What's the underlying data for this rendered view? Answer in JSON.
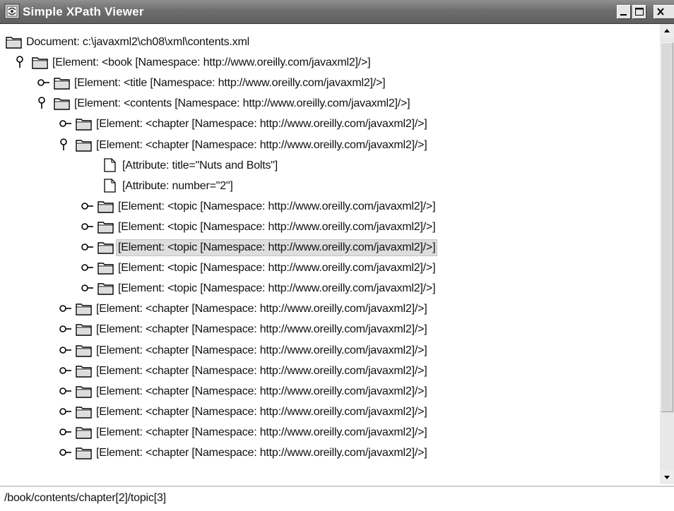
{
  "window": {
    "title": "Simple XPath Viewer",
    "buttons": [
      "minimize",
      "maximize",
      "close"
    ]
  },
  "tree": {
    "rows": [
      {
        "depth": 0,
        "type": "folder",
        "expanded": null,
        "selected": false,
        "label": "Document: c:\\javaxml2\\ch08\\xml\\contents.xml"
      },
      {
        "depth": 0,
        "type": "folder",
        "expanded": true,
        "selected": false,
        "label": "[Element: <book [Namespace: http://www.oreilly.com/javaxml2]/>]"
      },
      {
        "depth": 1,
        "type": "folder",
        "expanded": false,
        "selected": false,
        "label": "[Element: <title [Namespace: http://www.oreilly.com/javaxml2]/>]"
      },
      {
        "depth": 1,
        "type": "folder",
        "expanded": true,
        "selected": false,
        "label": "[Element: <contents [Namespace: http://www.oreilly.com/javaxml2]/>]"
      },
      {
        "depth": 2,
        "type": "folder",
        "expanded": false,
        "selected": false,
        "label": "[Element: <chapter [Namespace: http://www.oreilly.com/javaxml2]/>]"
      },
      {
        "depth": 2,
        "type": "folder",
        "expanded": true,
        "selected": false,
        "label": "[Element: <chapter [Namespace: http://www.oreilly.com/javaxml2]/>]"
      },
      {
        "depth": 3,
        "type": "leaf",
        "expanded": null,
        "selected": false,
        "label": "[Attribute: title=\"Nuts and Bolts\"]"
      },
      {
        "depth": 3,
        "type": "leaf",
        "expanded": null,
        "selected": false,
        "label": "[Attribute: number=\"2\"]"
      },
      {
        "depth": 3,
        "type": "folder",
        "expanded": false,
        "selected": false,
        "label": "[Element: <topic [Namespace: http://www.oreilly.com/javaxml2]/>]"
      },
      {
        "depth": 3,
        "type": "folder",
        "expanded": false,
        "selected": false,
        "label": "[Element: <topic [Namespace: http://www.oreilly.com/javaxml2]/>]"
      },
      {
        "depth": 3,
        "type": "folder",
        "expanded": false,
        "selected": true,
        "label": "[Element: <topic [Namespace: http://www.oreilly.com/javaxml2]/>]"
      },
      {
        "depth": 3,
        "type": "folder",
        "expanded": false,
        "selected": false,
        "label": "[Element: <topic [Namespace: http://www.oreilly.com/javaxml2]/>]"
      },
      {
        "depth": 3,
        "type": "folder",
        "expanded": false,
        "selected": false,
        "label": "[Element: <topic [Namespace: http://www.oreilly.com/javaxml2]/>]"
      },
      {
        "depth": 2,
        "type": "folder",
        "expanded": false,
        "selected": false,
        "label": "[Element: <chapter [Namespace: http://www.oreilly.com/javaxml2]/>]"
      },
      {
        "depth": 2,
        "type": "folder",
        "expanded": false,
        "selected": false,
        "label": "[Element: <chapter [Namespace: http://www.oreilly.com/javaxml2]/>]"
      },
      {
        "depth": 2,
        "type": "folder",
        "expanded": false,
        "selected": false,
        "label": "[Element: <chapter [Namespace: http://www.oreilly.com/javaxml2]/>]"
      },
      {
        "depth": 2,
        "type": "folder",
        "expanded": false,
        "selected": false,
        "label": "[Element: <chapter [Namespace: http://www.oreilly.com/javaxml2]/>]"
      },
      {
        "depth": 2,
        "type": "folder",
        "expanded": false,
        "selected": false,
        "label": "[Element: <chapter [Namespace: http://www.oreilly.com/javaxml2]/>]"
      },
      {
        "depth": 2,
        "type": "folder",
        "expanded": false,
        "selected": false,
        "label": "[Element: <chapter [Namespace: http://www.oreilly.com/javaxml2]/>]"
      },
      {
        "depth": 2,
        "type": "folder",
        "expanded": false,
        "selected": false,
        "label": "[Element: <chapter [Namespace: http://www.oreilly.com/javaxml2]/>]"
      },
      {
        "depth": 2,
        "type": "folder",
        "expanded": false,
        "selected": false,
        "label": "[Element: <chapter [Namespace: http://www.oreilly.com/javaxml2]/>]"
      }
    ]
  },
  "status": {
    "path": "/book/contents/chapter[2]/topic[3]"
  },
  "icons": {
    "app": "xpath-viewer-app-icon",
    "collapsed_handle": "tree-collapsed-handle-icon",
    "expanded_handle": "tree-expanded-handle-icon",
    "folder": "folder-icon",
    "leaf": "document-icon"
  }
}
